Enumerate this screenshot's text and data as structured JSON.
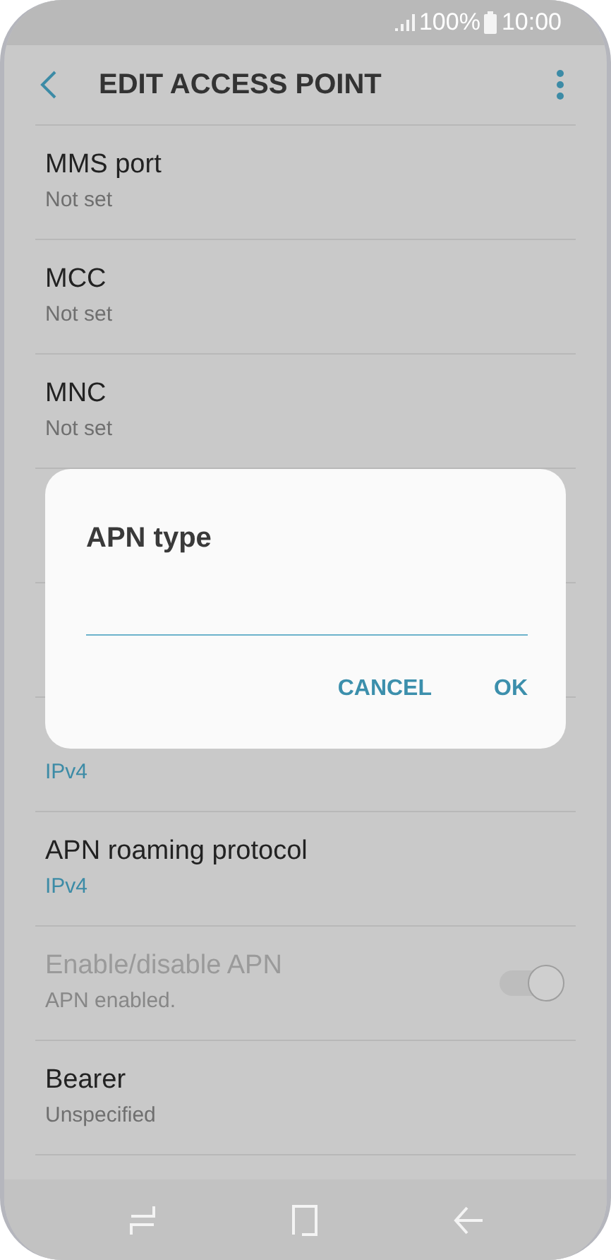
{
  "status_bar": {
    "battery": "100%",
    "time": "10:00"
  },
  "header": {
    "title": "EDIT ACCESS POINT"
  },
  "rows": [
    {
      "kind": "text",
      "title": "MMS port",
      "value": "Not set"
    },
    {
      "kind": "text",
      "title": "MCC",
      "value": "Not set"
    },
    {
      "kind": "text",
      "title": "MNC",
      "value": "Not set"
    },
    {
      "kind": "covered"
    },
    {
      "kind": "covered"
    },
    {
      "kind": "choice",
      "value": "IPv4"
    },
    {
      "kind": "choice",
      "title": "APN roaming protocol",
      "value": "IPv4"
    },
    {
      "kind": "toggle",
      "title": "Enable/disable APN",
      "value": "APN enabled.",
      "on": true,
      "disabled": true
    },
    {
      "kind": "text",
      "title": "Bearer",
      "value": "Unspecified"
    }
  ],
  "dialog": {
    "title": "APN type",
    "buttons": [
      "CANCEL",
      "OK"
    ]
  }
}
